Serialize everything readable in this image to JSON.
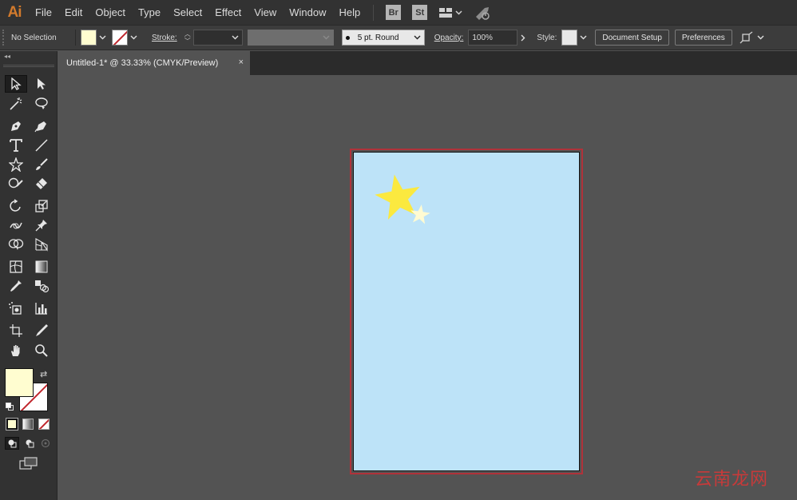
{
  "app": {
    "logo": "Ai"
  },
  "menu": [
    "File",
    "Edit",
    "Object",
    "Type",
    "Select",
    "Effect",
    "View",
    "Window",
    "Help"
  ],
  "menu_badges": [
    "Br",
    "St"
  ],
  "control": {
    "selection": "No Selection",
    "stroke_label": "Stroke:",
    "brush": "5 pt. Round",
    "opacity_label": "Opacity:",
    "opacity_value": "100%",
    "style_label": "Style:",
    "document_setup": "Document Setup",
    "preferences": "Preferences"
  },
  "tab": {
    "title": "Untitled-1* @ 33.33% (CMYK/Preview)",
    "close": "×"
  },
  "colors": {
    "fill": "#fffdd0",
    "stroke": "none",
    "artboard_bg": "#bde3f8",
    "star_large": "#fbe93f",
    "star_small": "#fffbd2",
    "artboard_outline": "#b0323a"
  },
  "tools": [
    "selection-tool",
    "direct-selection-tool",
    "magic-wand-tool",
    "lasso-tool",
    "pen-tool",
    "curvature-tool",
    "type-tool",
    "line-segment-tool",
    "star-tool",
    "paintbrush-tool",
    "shaper-tool",
    "eraser-tool",
    "rotate-tool",
    "scale-tool",
    "warp-tool",
    "puppet-warp-tool",
    "shape-builder-tool",
    "perspective-grid-tool",
    "mesh-tool",
    "gradient-tool",
    "eyedropper-tool",
    "blend-tool",
    "symbol-sprayer-tool",
    "column-graph-tool",
    "artboard-tool",
    "slice-tool",
    "hand-tool",
    "zoom-tool"
  ],
  "watermark": "云南龙网"
}
